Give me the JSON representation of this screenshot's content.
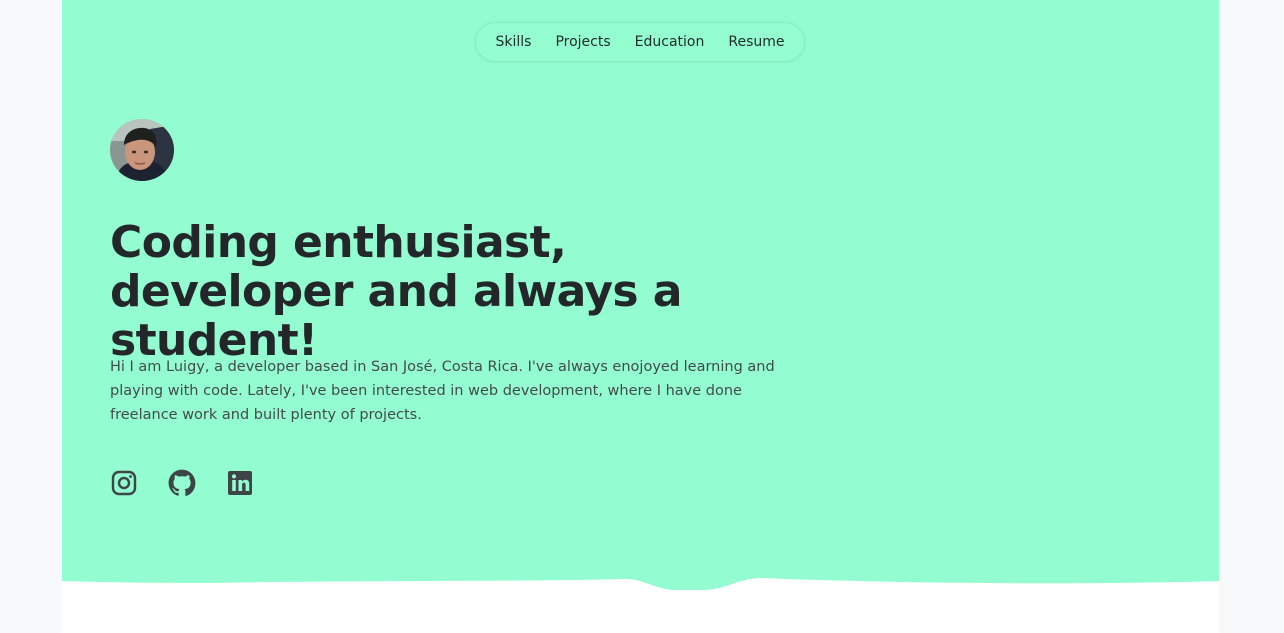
{
  "nav": {
    "items": [
      {
        "label": "Skills"
      },
      {
        "label": "Projects"
      },
      {
        "label": "Education"
      },
      {
        "label": "Resume"
      }
    ]
  },
  "hero": {
    "headline": "Coding enthusiast, developer and always a student!",
    "intro": "Hi I am Luigy, a developer based in San José, Costa Rica. I've always enojoyed learning and playing with code. Lately, I've been interested in web development, where I have done freelance work and built plenty of projects.",
    "socials": [
      {
        "icon": "instagram-icon"
      },
      {
        "icon": "github-icon"
      },
      {
        "icon": "linkedin-icon"
      }
    ]
  },
  "colors": {
    "hero_bg": "#93fdd1",
    "text_dark": "#24272a",
    "text_body": "#434a4c",
    "page_bg": "#ffffff",
    "outer_bg": "#f8f9fb"
  }
}
